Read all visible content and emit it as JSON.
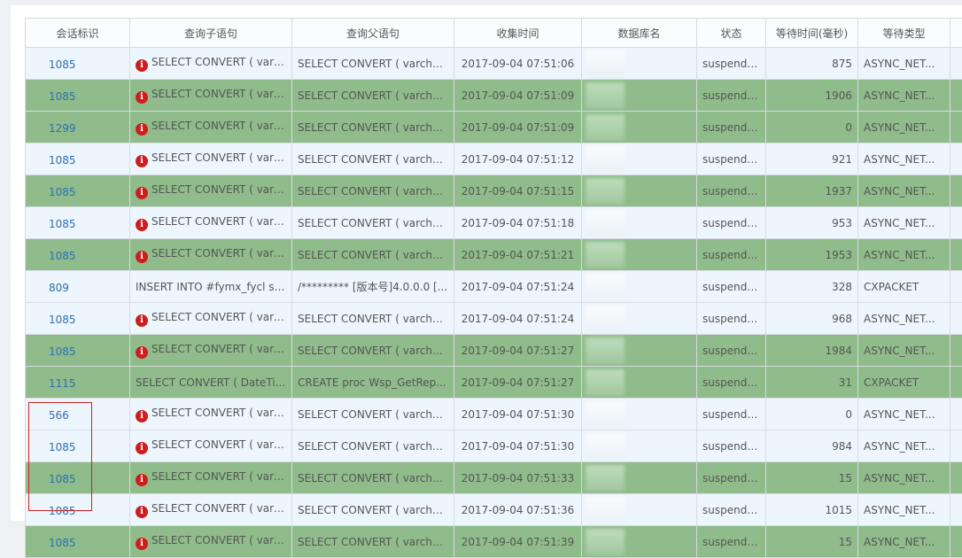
{
  "columns": [
    "会话标识",
    "查询子语句",
    "查询父语句",
    "收集时间",
    "数据库名",
    "状态",
    "等待时间(毫秒)",
    "等待类型"
  ],
  "rows": [
    {
      "sid": "1085",
      "err": true,
      "child": "SELECT CONVERT ( varc...",
      "parent": "SELECT CONVERT ( varchar...",
      "time": "2017-09-04 07:51:06",
      "status": "suspended",
      "wait": "875",
      "type": "ASYNC_NET...",
      "style": "light"
    },
    {
      "sid": "1085",
      "err": true,
      "child": "SELECT CONVERT ( varc...",
      "parent": "SELECT CONVERT ( varchar...",
      "time": "2017-09-04 07:51:09",
      "status": "suspended",
      "wait": "1906",
      "type": "ASYNC_NET...",
      "style": "green"
    },
    {
      "sid": "1299",
      "err": true,
      "child": "SELECT CONVERT ( varc...",
      "parent": "SELECT CONVERT ( varchar...",
      "time": "2017-09-04 07:51:09",
      "status": "suspended",
      "wait": "0",
      "type": "ASYNC_NET...",
      "style": "green"
    },
    {
      "sid": "1085",
      "err": true,
      "child": "SELECT CONVERT ( varc...",
      "parent": "SELECT CONVERT ( varchar...",
      "time": "2017-09-04 07:51:12",
      "status": "suspended",
      "wait": "921",
      "type": "ASYNC_NET...",
      "style": "light"
    },
    {
      "sid": "1085",
      "err": true,
      "child": "SELECT CONVERT ( varc...",
      "parent": "SELECT CONVERT ( varchar...",
      "time": "2017-09-04 07:51:15",
      "status": "suspended",
      "wait": "1937",
      "type": "ASYNC_NET...",
      "style": "green"
    },
    {
      "sid": "1085",
      "err": true,
      "child": "SELECT CONVERT ( varc...",
      "parent": "SELECT CONVERT ( varchar...",
      "time": "2017-09-04 07:51:18",
      "status": "suspended",
      "wait": "953",
      "type": "ASYNC_NET...",
      "style": "light"
    },
    {
      "sid": "1085",
      "err": true,
      "child": "SELECT CONVERT ( varc...",
      "parent": "SELECT CONVERT ( varchar...",
      "time": "2017-09-04 07:51:21",
      "status": "suspended",
      "wait": "1953",
      "type": "ASYNC_NET...",
      "style": "green"
    },
    {
      "sid": "809",
      "err": false,
      "child": "INSERT INTO #fymx_fycl se...",
      "parent": "/********* [版本号]4.0.0.0 [...",
      "time": "2017-09-04 07:51:24",
      "status": "suspended",
      "wait": "328",
      "type": "CXPACKET",
      "style": "light"
    },
    {
      "sid": "1085",
      "err": true,
      "child": "SELECT CONVERT ( varc...",
      "parent": "SELECT CONVERT ( varchar...",
      "time": "2017-09-04 07:51:24",
      "status": "suspended",
      "wait": "968",
      "type": "ASYNC_NET...",
      "style": "light"
    },
    {
      "sid": "1085",
      "err": true,
      "child": "SELECT CONVERT ( varc...",
      "parent": "SELECT CONVERT ( varchar...",
      "time": "2017-09-04 07:51:27",
      "status": "suspended",
      "wait": "1984",
      "type": "ASYNC_NET...",
      "style": "green"
    },
    {
      "sid": "1115",
      "err": false,
      "child": "SELECT CONVERT ( DateTi...",
      "parent": "CREATE proc Wsp_GetRep...",
      "time": "2017-09-04 07:51:27",
      "status": "suspended",
      "wait": "31",
      "type": "CXPACKET",
      "style": "green"
    },
    {
      "sid": "566",
      "err": true,
      "child": "SELECT CONVERT ( varc...",
      "parent": "SELECT CONVERT ( varchar...",
      "time": "2017-09-04 07:51:30",
      "status": "suspended",
      "wait": "0",
      "type": "ASYNC_NET...",
      "style": "light"
    },
    {
      "sid": "1085",
      "err": true,
      "child": "SELECT CONVERT ( varc...",
      "parent": "SELECT CONVERT ( varchar...",
      "time": "2017-09-04 07:51:30",
      "status": "suspended",
      "wait": "984",
      "type": "ASYNC_NET...",
      "style": "light"
    },
    {
      "sid": "1085",
      "err": true,
      "child": "SELECT CONVERT ( varc...",
      "parent": "SELECT CONVERT ( varchar...",
      "time": "2017-09-04 07:51:33",
      "status": "suspended",
      "wait": "15",
      "type": "ASYNC_NET...",
      "style": "green"
    },
    {
      "sid": "1085",
      "err": true,
      "child": "SELECT CONVERT ( varc...",
      "parent": "SELECT CONVERT ( varchar...",
      "time": "2017-09-04 07:51:36",
      "status": "suspended",
      "wait": "1015",
      "type": "ASYNC_NET...",
      "style": "light"
    },
    {
      "sid": "1085",
      "err": true,
      "child": "SELECT CONVERT ( varc...",
      "parent": "SELECT CONVERT ( varchar...",
      "time": "2017-09-04 07:51:39",
      "status": "suspended",
      "wait": "15",
      "type": "ASYNC_NET...",
      "style": "green"
    }
  ],
  "colors": {
    "green_row": "#8fbc8a",
    "light_row": "#eef6fd",
    "link": "#2d6fb3",
    "error": "#cc1e1e",
    "highlight": "#d02020"
  },
  "icons": {
    "error": "error-circle-icon"
  },
  "error_glyph": "i"
}
